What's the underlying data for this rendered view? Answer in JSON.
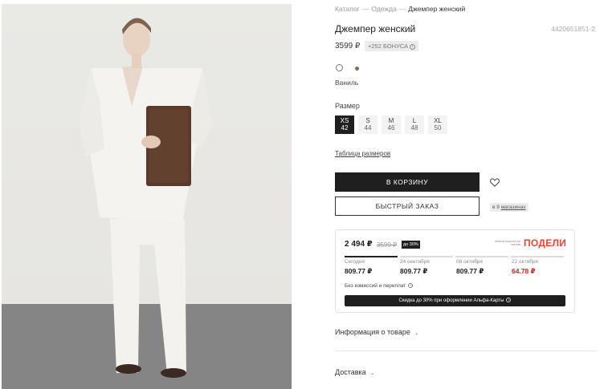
{
  "breadcrumb": [
    {
      "label": "Каталог"
    },
    {
      "label": "Одежда"
    },
    {
      "label": "Джемпер женский"
    }
  ],
  "breadcrumb_separator": "—",
  "product": {
    "title": "Джемпер женский",
    "sku": "4420651851-2",
    "price": "3599 ₽",
    "bonus": "+252 БОНУСА",
    "bonus_info_icon": "info-icon"
  },
  "colors": {
    "options": [
      {
        "icon": "color-swatch-white",
        "color": "#ffffff"
      },
      {
        "icon": "color-swatch-brown",
        "color": "#8a6a55"
      }
    ],
    "selected_name": "Ваниль"
  },
  "sizes": {
    "label": "Размер",
    "options": [
      {
        "name": "XS",
        "value": "42",
        "selected": true
      },
      {
        "name": "S",
        "value": "44",
        "selected": false
      },
      {
        "name": "M",
        "value": "46",
        "selected": false
      },
      {
        "name": "L",
        "value": "48",
        "selected": false
      },
      {
        "name": "XL",
        "value": "50",
        "selected": false
      }
    ],
    "table_link": "Таблица размеров"
  },
  "actions": {
    "add_to_cart": "В КОРЗИНУ",
    "quick_order": "БЫСТРЫЙ ЗАКАЗ",
    "stores_prefix": "в 9",
    "stores_link": "магазинах",
    "favorite_icon": "heart-icon"
  },
  "podeli": {
    "price": "2 494 ₽",
    "old_price": "3599 ₽",
    "discount": "до 30%",
    "tagline": "оплата покупок по частям",
    "logo": "ПОДЕЛИ",
    "payments": [
      {
        "date": "Сегодня",
        "amount": "809.77 ₽",
        "highlight": false
      },
      {
        "date": "24 сентября",
        "amount": "809.77 ₽",
        "highlight": false
      },
      {
        "date": "08 октября",
        "amount": "809.77 ₽",
        "highlight": false
      },
      {
        "date": "22 октября",
        "amount": "64.78 ₽",
        "highlight": true
      }
    ],
    "note": "Без комиссий и переплат",
    "promo": "Скидка до 30% при оформлении Альфа-Карты"
  },
  "accordion": {
    "info": "Информация о товаре",
    "delivery": "Доставка"
  },
  "colors_theme": {
    "accent_dark": "#1f1f1f",
    "podeli_red": "#ff3b30",
    "highlight_red": "#e02020"
  }
}
